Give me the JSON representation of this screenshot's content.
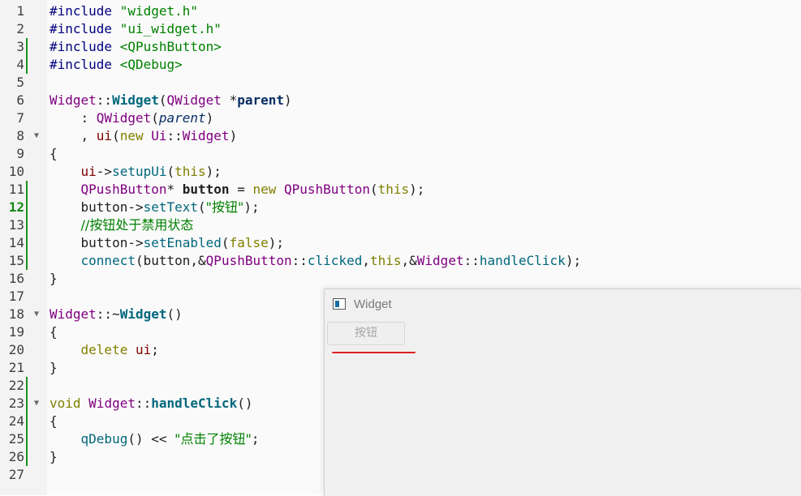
{
  "editor": {
    "current_line": 12,
    "lines": [
      {
        "n": "1",
        "tokens": [
          [
            "t-prep",
            "#include "
          ],
          [
            "t-str",
            "\"widget.h\""
          ]
        ]
      },
      {
        "n": "2",
        "tokens": [
          [
            "t-prep",
            "#include "
          ],
          [
            "t-str",
            "\"ui_widget.h\""
          ]
        ]
      },
      {
        "n": "3",
        "mod": true,
        "tokens": [
          [
            "t-prep",
            "#include "
          ],
          [
            "t-inc",
            "<QPushButton>"
          ]
        ]
      },
      {
        "n": "4",
        "mod": true,
        "tokens": [
          [
            "t-prep",
            "#include "
          ],
          [
            "t-inc",
            "<QDebug>"
          ]
        ]
      },
      {
        "n": "5",
        "tokens": []
      },
      {
        "n": "6",
        "tokens": [
          [
            "t-cls",
            "Widget"
          ],
          [
            "t-op",
            "::"
          ],
          [
            "t-fn",
            "Widget"
          ],
          [
            "t-op",
            "("
          ],
          [
            "t-cls",
            "QWidget"
          ],
          [
            "t-op",
            " *"
          ],
          [
            "t-param",
            "parent"
          ],
          [
            "t-op",
            ")"
          ]
        ]
      },
      {
        "n": "7",
        "tokens": [
          [
            "t-op",
            "    : "
          ],
          [
            "t-cls",
            "QWidget"
          ],
          [
            "t-op",
            "("
          ],
          [
            "t-parami",
            "parent"
          ],
          [
            "t-op",
            ")"
          ]
        ]
      },
      {
        "n": "8",
        "fold": true,
        "tokens": [
          [
            "t-op",
            "    , "
          ],
          [
            "t-mem",
            "ui"
          ],
          [
            "t-op",
            "("
          ],
          [
            "t-kw",
            "new "
          ],
          [
            "t-cls",
            "Ui"
          ],
          [
            "t-op",
            "::"
          ],
          [
            "t-cls",
            "Widget"
          ],
          [
            "t-op",
            ")"
          ]
        ]
      },
      {
        "n": "9",
        "tokens": [
          [
            "t-op",
            "{"
          ]
        ]
      },
      {
        "n": "10",
        "tokens": [
          [
            "t-op",
            "    "
          ],
          [
            "t-mem",
            "ui"
          ],
          [
            "t-op",
            "->"
          ],
          [
            "t-mfn",
            "setupUi"
          ],
          [
            "t-op",
            "("
          ],
          [
            "t-kw",
            "this"
          ],
          [
            "t-op",
            ");"
          ]
        ]
      },
      {
        "n": "11",
        "mod": true,
        "tokens": [
          [
            "t-op",
            "    "
          ],
          [
            "t-cls",
            "QPushButton"
          ],
          [
            "t-op",
            "* "
          ],
          [
            "t-bold",
            "button"
          ],
          [
            "t-op",
            " = "
          ],
          [
            "t-kw",
            "new "
          ],
          [
            "t-cls",
            "QPushButton"
          ],
          [
            "t-op",
            "("
          ],
          [
            "t-kw",
            "this"
          ],
          [
            "t-op",
            ");"
          ]
        ]
      },
      {
        "n": "12",
        "mod": true,
        "tokens": [
          [
            "t-op",
            "    button->"
          ],
          [
            "t-mfn",
            "setText"
          ],
          [
            "t-op",
            "("
          ],
          [
            "t-str",
            "\"按钮\""
          ],
          [
            "t-op",
            ");"
          ]
        ]
      },
      {
        "n": "13",
        "mod": true,
        "tokens": [
          [
            "t-op",
            "    "
          ],
          [
            "t-com",
            "//按钮处于禁用状态"
          ]
        ]
      },
      {
        "n": "14",
        "mod": true,
        "tokens": [
          [
            "t-op",
            "    button->"
          ],
          [
            "t-mfn",
            "setEnabled"
          ],
          [
            "t-op",
            "("
          ],
          [
            "t-kw",
            "false"
          ],
          [
            "t-op",
            ");"
          ]
        ]
      },
      {
        "n": "15",
        "mod": true,
        "tokens": [
          [
            "t-op",
            "    "
          ],
          [
            "t-mfn",
            "connect"
          ],
          [
            "t-op",
            "(button,&"
          ],
          [
            "t-cls",
            "QPushButton"
          ],
          [
            "t-op",
            "::"
          ],
          [
            "t-mfn",
            "clicked"
          ],
          [
            "t-op",
            ","
          ],
          [
            "t-kw",
            "this"
          ],
          [
            "t-op",
            ",&"
          ],
          [
            "t-cls",
            "Widget"
          ],
          [
            "t-op",
            "::"
          ],
          [
            "t-mfn",
            "handleClick"
          ],
          [
            "t-op",
            ");"
          ]
        ]
      },
      {
        "n": "16",
        "tokens": [
          [
            "t-op",
            "}"
          ]
        ]
      },
      {
        "n": "17",
        "tokens": []
      },
      {
        "n": "18",
        "fold": true,
        "tokens": [
          [
            "t-cls",
            "Widget"
          ],
          [
            "t-op",
            "::~"
          ],
          [
            "t-fn",
            "Widget"
          ],
          [
            "t-op",
            "()"
          ]
        ]
      },
      {
        "n": "19",
        "tokens": [
          [
            "t-op",
            "{"
          ]
        ]
      },
      {
        "n": "20",
        "tokens": [
          [
            "t-op",
            "    "
          ],
          [
            "t-kw",
            "delete "
          ],
          [
            "t-mem",
            "ui"
          ],
          [
            "t-op",
            ";"
          ]
        ]
      },
      {
        "n": "21",
        "tokens": [
          [
            "t-op",
            "}"
          ]
        ]
      },
      {
        "n": "22",
        "mod": true,
        "tokens": []
      },
      {
        "n": "23",
        "mod": true,
        "fold": true,
        "tokens": [
          [
            "t-kw",
            "void "
          ],
          [
            "t-cls",
            "Widget"
          ],
          [
            "t-op",
            "::"
          ],
          [
            "t-fn",
            "handleClick"
          ],
          [
            "t-op",
            "()"
          ]
        ]
      },
      {
        "n": "24",
        "mod": true,
        "tokens": [
          [
            "t-op",
            "{"
          ]
        ]
      },
      {
        "n": "25",
        "mod": true,
        "tokens": [
          [
            "t-op",
            "    "
          ],
          [
            "t-mfn",
            "qDebug"
          ],
          [
            "t-op",
            "() << "
          ],
          [
            "t-str",
            "\"点击了按钮\""
          ],
          [
            "t-op",
            ";"
          ]
        ]
      },
      {
        "n": "26",
        "mod": true,
        "tokens": [
          [
            "t-op",
            "}"
          ]
        ]
      },
      {
        "n": "27",
        "tokens": []
      }
    ]
  },
  "widget_window": {
    "title": "Widget",
    "button_label": "按钮",
    "underline_color": "#e02020",
    "button_enabled": false
  }
}
